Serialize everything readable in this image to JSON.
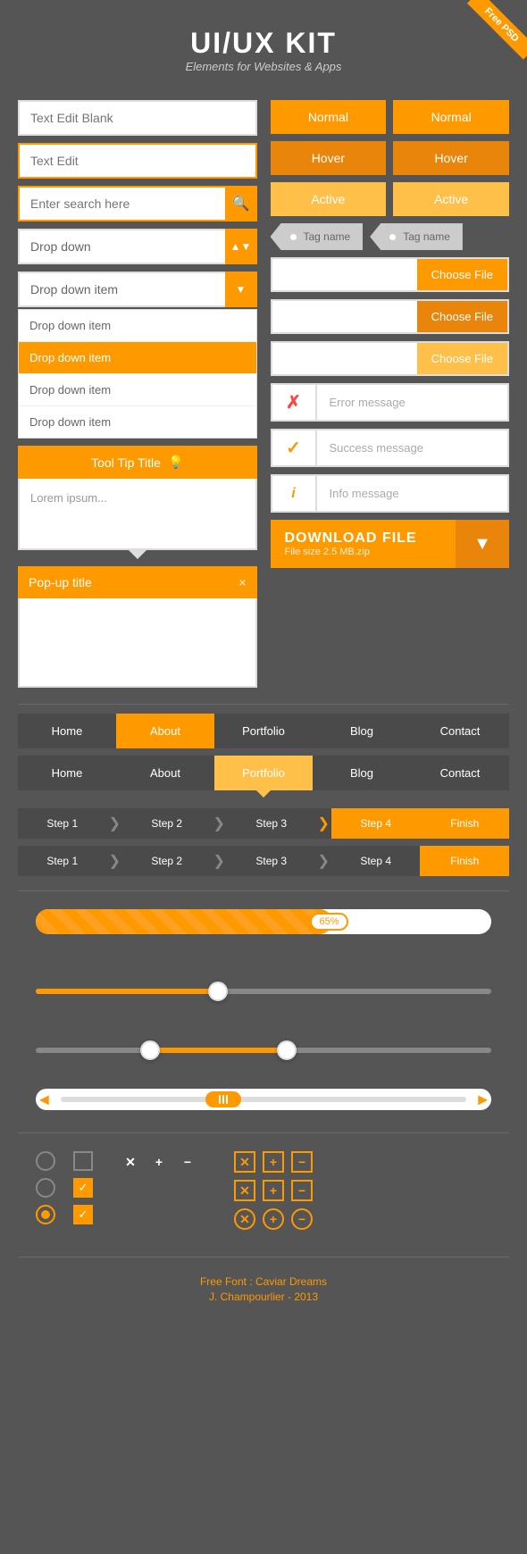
{
  "header": {
    "title": "UI/UX KIT",
    "subtitle": "Elements for Websites & Apps",
    "badge": "Free PSD"
  },
  "left_col": {
    "text_edit_blank": "Text Edit Blank",
    "text_edit": "Text Edit",
    "search_placeholder": "Enter search here",
    "dropdown_label": "Drop down",
    "dropdown_item_label": "Drop down item",
    "dropdown_list": [
      {
        "label": "Drop down item",
        "selected": false
      },
      {
        "label": "Drop down item",
        "selected": true
      },
      {
        "label": "Drop down item",
        "selected": false
      },
      {
        "label": "Drop down item",
        "selected": false
      }
    ],
    "tooltip_title": "Tool Tip Title",
    "tooltip_body": "Lorem ipsum...",
    "popup_title": "Pop-up title",
    "popup_close": "×"
  },
  "right_col": {
    "btn_normal_1": "Normal",
    "btn_normal_2": "Normal",
    "btn_hover_1": "Hover",
    "btn_hover_2": "Hover",
    "btn_active_1": "Active",
    "btn_active_2": "Active",
    "tag_1": "Tag name",
    "tag_2": "Tag name",
    "choose_file_1": "Choose File",
    "choose_file_2": "Choose File",
    "choose_file_3": "Choose File",
    "error_msg": "Error message",
    "success_msg": "Success message",
    "info_msg": "Info message",
    "download_title": "DOWNLOAD FILE",
    "download_subtitle": "File size 2.5 MB.zip"
  },
  "nav1": {
    "items": [
      {
        "label": "Home",
        "active": false
      },
      {
        "label": "About",
        "active": true
      },
      {
        "label": "Portfolio",
        "active": false
      },
      {
        "label": "Blog",
        "active": false
      },
      {
        "label": "Contact",
        "active": false
      }
    ]
  },
  "nav2": {
    "items": [
      {
        "label": "Home",
        "active": false
      },
      {
        "label": "About",
        "active": false
      },
      {
        "label": "Portfolio",
        "active": true
      },
      {
        "label": "Blog",
        "active": false
      },
      {
        "label": "Contact",
        "active": false
      }
    ]
  },
  "steps1": {
    "items": [
      {
        "label": "Step 1",
        "active": false
      },
      {
        "label": "Step 2",
        "active": false
      },
      {
        "label": "Step 3",
        "active": false
      },
      {
        "label": "Step 4",
        "active": true
      },
      {
        "label": "Finish",
        "active": true
      }
    ]
  },
  "steps2": {
    "items": [
      {
        "label": "Step 1",
        "active": false
      },
      {
        "label": "Step 2",
        "active": false
      },
      {
        "label": "Step 3",
        "active": false
      },
      {
        "label": "Step 4",
        "active": false
      },
      {
        "label": "Finish",
        "active": true
      }
    ]
  },
  "progress": {
    "value": 65,
    "label": "65%"
  },
  "footer": {
    "font_line": "Free Font : Caviar Dreams",
    "credit_line": "J. Champourlier - 2013"
  }
}
